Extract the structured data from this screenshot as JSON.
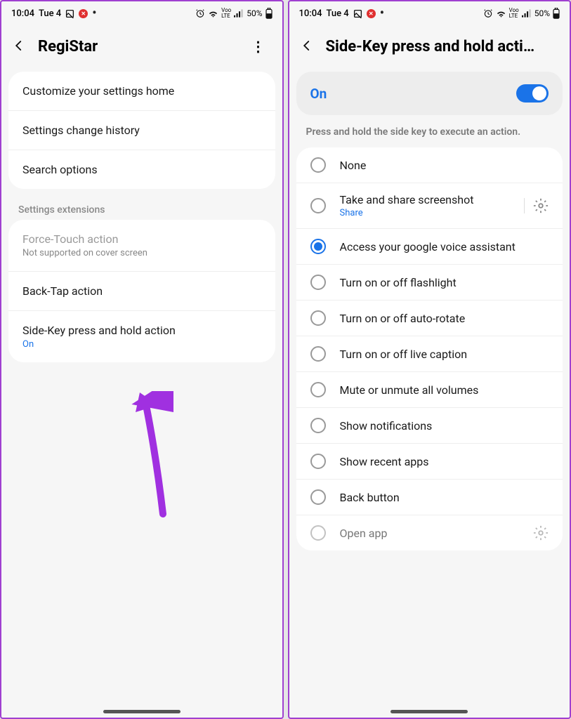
{
  "status": {
    "time": "10:04",
    "date": "Tue 4",
    "battery": "50%",
    "network": "Voo LTE"
  },
  "left": {
    "title": "RegiStar",
    "items": {
      "customize": "Customize your settings home",
      "history": "Settings change history",
      "search": "Search options"
    },
    "sectionLabel": "Settings extensions",
    "extensions": {
      "forceTouch": {
        "title": "Force-Touch action",
        "sub": "Not supported on cover screen"
      },
      "backTap": "Back-Tap action",
      "sideKey": {
        "title": "Side-Key press and hold action",
        "sub": "On"
      }
    }
  },
  "right": {
    "title": "Side-Key press and hold acti…",
    "toggleLabel": "On",
    "description": "Press and hold the side key to execute an action.",
    "options": {
      "none": "None",
      "screenshot": {
        "title": "Take and share screenshot",
        "sub": "Share"
      },
      "assistant": "Access your google voice assistant",
      "flashlight": "Turn on or off flashlight",
      "rotate": "Turn on or off auto-rotate",
      "caption": "Turn on or off live caption",
      "mute": "Mute or unmute all volumes",
      "notif": "Show notifications",
      "recent": "Show recent apps",
      "back": "Back button",
      "openapp": "Open app"
    }
  }
}
